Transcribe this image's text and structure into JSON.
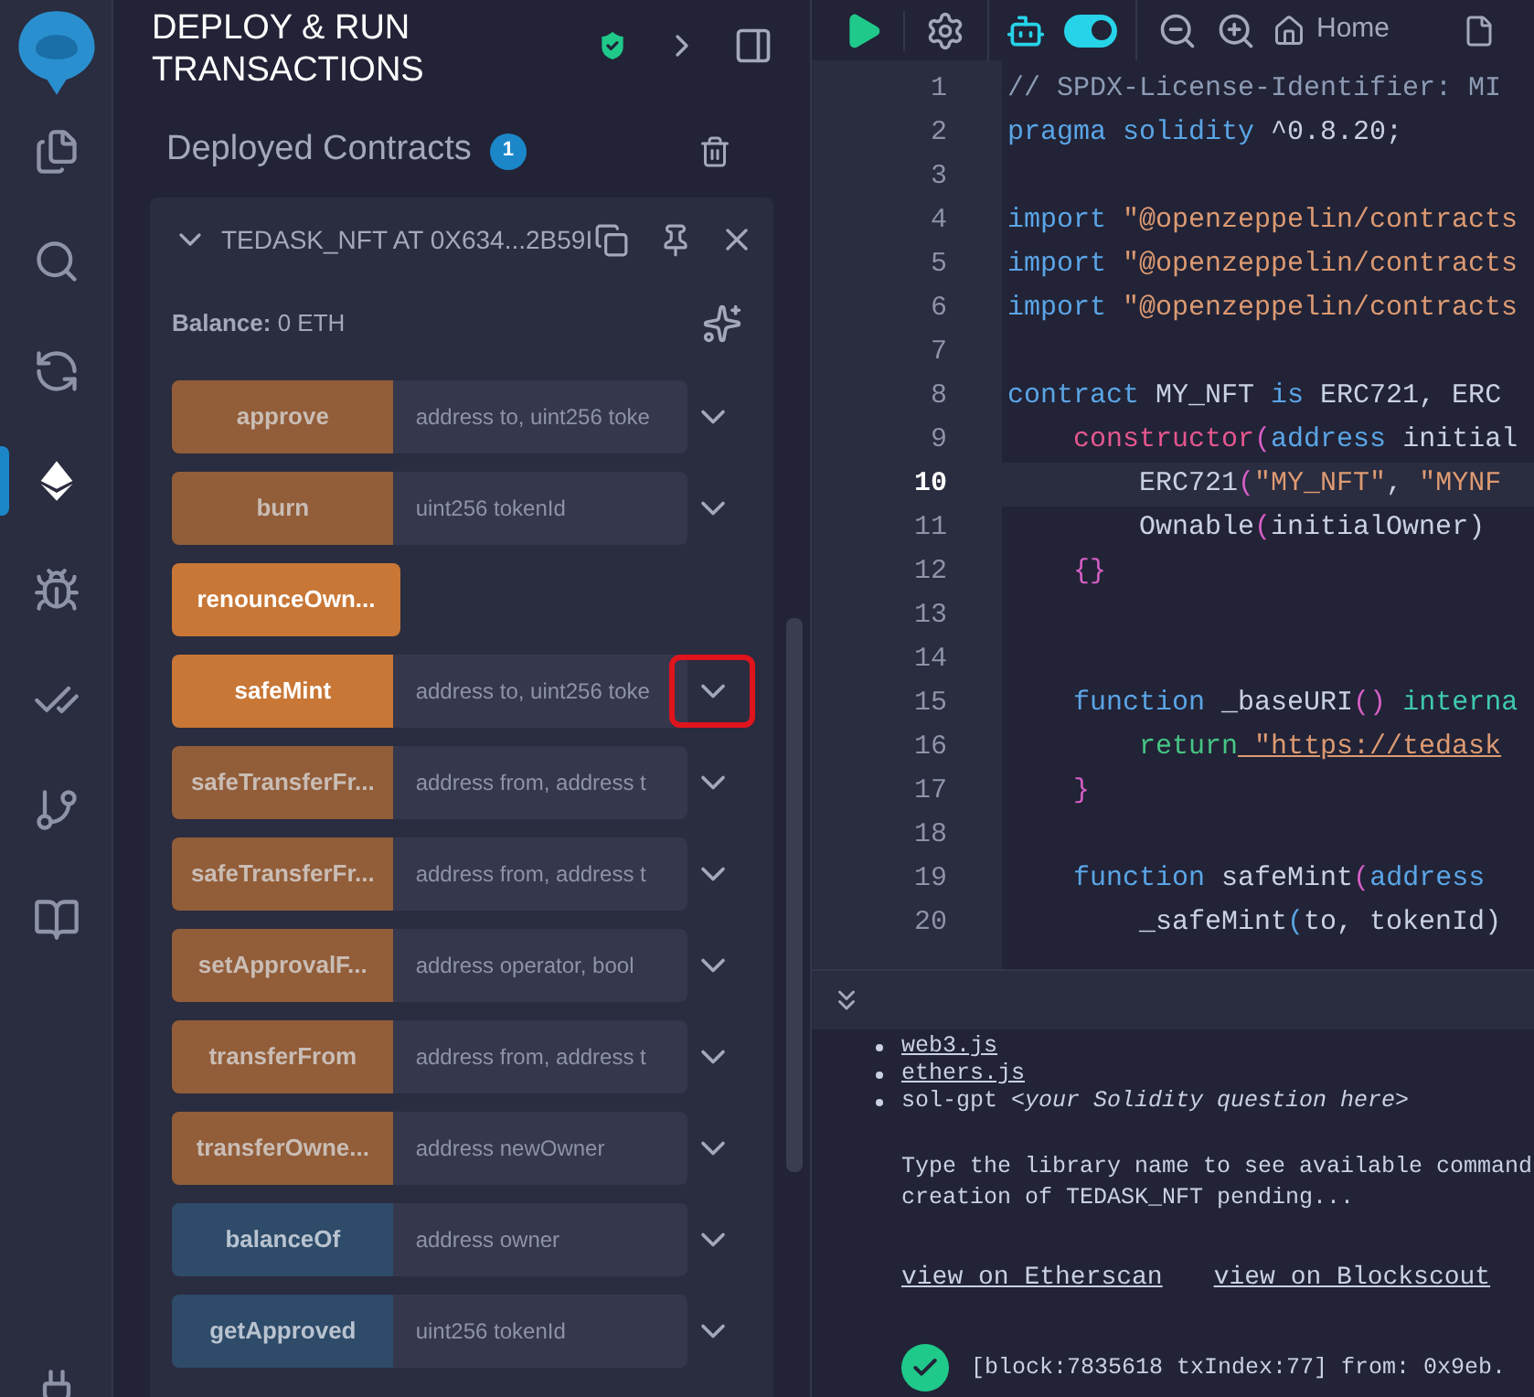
{
  "sidebar": {
    "items": [
      {
        "kind": "files",
        "selected": false
      },
      {
        "kind": "search",
        "selected": false
      },
      {
        "kind": "compile",
        "selected": false
      },
      {
        "kind": "deploy",
        "selected": true
      },
      {
        "kind": "debug",
        "selected": false
      },
      {
        "kind": "tests",
        "selected": false
      },
      {
        "kind": "git",
        "selected": false
      },
      {
        "kind": "learn",
        "selected": false
      },
      {
        "kind": "plugin",
        "selected": false
      }
    ]
  },
  "panel": {
    "title": "DEPLOY & RUN TRANSACTIONS",
    "section_title": "Deployed Contracts",
    "count": "1",
    "contract": {
      "title": "TEDASK_NFT AT 0X634...2B59I",
      "expanded": true,
      "balance": "**Balance:** 0 ETH",
      "functions": [
        {
          "name": "approve",
          "kind": "transact",
          "active": false,
          "placeholder": "address to, uint256 toke",
          "highlighted": false
        },
        {
          "name": "burn",
          "kind": "transact",
          "active": false,
          "placeholder": "uint256 tokenId",
          "highlighted": false
        },
        {
          "name": "renounceOwn...",
          "kind": "transact",
          "active": true
        },
        {
          "name": "safeMint",
          "kind": "transact",
          "active": true,
          "placeholder": "address to, uint256 toke",
          "highlighted": true
        },
        {
          "name": "safeTransferFr...",
          "kind": "transact",
          "active": false,
          "placeholder": "address from, address t",
          "highlighted": false
        },
        {
          "name": "safeTransferFr...",
          "kind": "transact",
          "active": false,
          "placeholder": "address from, address t",
          "highlighted": false
        },
        {
          "name": "setApprovalF...",
          "kind": "transact",
          "active": false,
          "placeholder": "address operator, bool",
          "highlighted": false
        },
        {
          "name": "transferFrom",
          "kind": "transact",
          "active": false,
          "placeholder": "address from, address t",
          "highlighted": false
        },
        {
          "name": "transferOwne...",
          "kind": "transact",
          "active": false,
          "placeholder": "address newOwner",
          "highlighted": false
        },
        {
          "name": "balanceOf",
          "kind": "call",
          "active": false,
          "placeholder": "address owner",
          "highlighted": false
        },
        {
          "name": "getApproved",
          "kind": "call",
          "active": false,
          "placeholder": "uint256 tokenId",
          "highlighted": false
        }
      ]
    }
  },
  "toolbar": {
    "ai_toggle": {
      "on": true
    },
    "home_tab": "Home"
  },
  "editor": {
    "lines": [
      {
        "number": "1",
        "current": false,
        "tokens": [
          {
            "text": "// SPDX-License-Identifier: MI",
            "kind": "comment"
          }
        ]
      },
      {
        "number": "2",
        "current": false,
        "tokens": [
          {
            "text": "pragma solidity",
            "kind": "keyword"
          },
          {
            "text": " ^0.8.20;",
            "kind": "plain"
          }
        ]
      },
      {
        "number": "3",
        "current": false
      },
      {
        "number": "4",
        "current": false,
        "tokens": [
          {
            "text": "import",
            "kind": "keyword"
          },
          {
            "text": " \"@openzeppelin/contracts",
            "kind": "string"
          }
        ]
      },
      {
        "number": "5",
        "current": false,
        "tokens": [
          {
            "text": "import",
            "kind": "keyword"
          },
          {
            "text": " \"@openzeppelin/contracts",
            "kind": "string"
          }
        ]
      },
      {
        "number": "6",
        "current": false,
        "tokens": [
          {
            "text": "import",
            "kind": "keyword"
          },
          {
            "text": " \"@openzeppelin/contracts",
            "kind": "string"
          }
        ]
      },
      {
        "number": "7",
        "current": false
      },
      {
        "number": "8",
        "current": false,
        "tokens": [
          {
            "text": "contract",
            "kind": "keyword"
          },
          {
            "text": " MY_NFT ",
            "kind": "plain"
          },
          {
            "text": "is",
            "kind": "keyword"
          },
          {
            "text": " ERC721, ERC",
            "kind": "plain"
          }
        ]
      },
      {
        "number": "9",
        "current": false,
        "tokens": [
          {
            "text": "    constructor",
            "kind": "special"
          },
          {
            "text": "(",
            "kind": "bracket"
          },
          {
            "text": "address",
            "kind": "keyword"
          },
          {
            "text": " initial",
            "kind": "plain"
          }
        ]
      },
      {
        "number": "10",
        "current": true,
        "tokens": [
          {
            "text": "        ERC721",
            "kind": "plain"
          },
          {
            "text": "(",
            "kind": "bracket"
          },
          {
            "text": "\"MY_NFT\"",
            "kind": "string"
          },
          {
            "text": ", ",
            "kind": "plain"
          },
          {
            "text": "\"MYNF",
            "kind": "string"
          }
        ]
      },
      {
        "number": "11",
        "current": false,
        "tokens": [
          {
            "text": "        Ownable",
            "kind": "plain"
          },
          {
            "text": "(",
            "kind": "bracket"
          },
          {
            "text": "initialOwner)",
            "kind": "plain"
          }
        ]
      },
      {
        "number": "12",
        "current": false,
        "tokens": [
          {
            "text": "    {}",
            "kind": "bracket"
          }
        ]
      },
      {
        "number": "13",
        "current": false
      },
      {
        "number": "14",
        "current": false
      },
      {
        "number": "15",
        "current": false,
        "tokens": [
          {
            "text": "    function",
            "kind": "keyword"
          },
          {
            "text": " _baseURI",
            "kind": "plain"
          },
          {
            "text": "()",
            "kind": "bracket"
          },
          {
            "text": " interna",
            "kind": "type"
          }
        ]
      },
      {
        "number": "16",
        "current": false,
        "tokens": [
          {
            "text": "        return",
            "kind": "control"
          },
          {
            "text": " \"https://tedask",
            "kind": "string"
          }
        ]
      },
      {
        "number": "17",
        "current": false,
        "tokens": [
          {
            "text": "    }",
            "kind": "bracket"
          }
        ]
      },
      {
        "number": "18",
        "current": false
      },
      {
        "number": "19",
        "current": false,
        "tokens": [
          {
            "text": "    function",
            "kind": "keyword"
          },
          {
            "text": " safeMint",
            "kind": "plain"
          },
          {
            "text": "(",
            "kind": "bracket"
          },
          {
            "text": "address",
            "kind": "keyword"
          }
        ]
      },
      {
        "number": "20",
        "current": false,
        "tokens": [
          {
            "text": "        _safeMint",
            "kind": "plain"
          },
          {
            "text": "(",
            "kind": "keyword"
          },
          {
            "text": "to, tokenId)",
            "kind": "plain"
          }
        ]
      }
    ]
  },
  "terminal": {
    "libraries": [
      {
        "text": "web3.js",
        "kind": "link"
      },
      {
        "text": "ethers.js",
        "kind": "link"
      },
      {
        "text": "sol-gpt *<your Solidity question here>*",
        "kind": "text"
      }
    ],
    "hint": "Type the library name to see available command",
    "status": "creation of TEDASK_NFT pending...",
    "links": [
      "view on Etherscan",
      "view on Blockscout"
    ],
    "tx": {
      "ok": true,
      "text": "[block:7835618 txIndex:77] from: 0x9eb."
    }
  }
}
